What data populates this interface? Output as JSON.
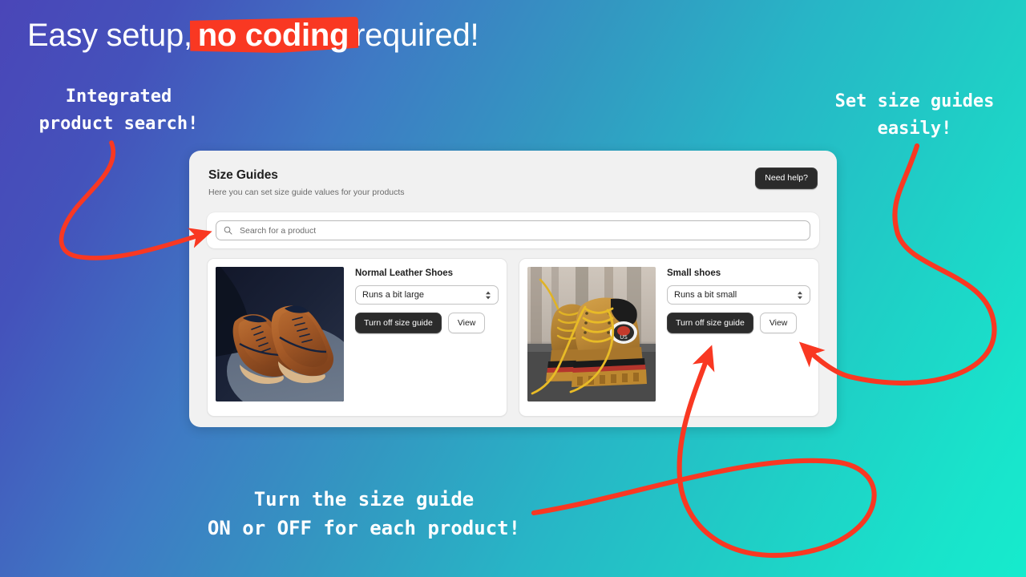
{
  "promo": {
    "headline_pre": "Easy setup,",
    "headline_highlight": "no coding",
    "headline_post": "required!",
    "callout_search": "Integrated\nproduct search!",
    "callout_sizes": "Set size guides\neasily!",
    "callout_toggle": "Turn the size guide\nON or OFF for each product!",
    "accent_color": "#f93822",
    "bg_from": "#4a46b8",
    "bg_to": "#16ebcd"
  },
  "app": {
    "title": "Size Guides",
    "subtitle": "Here you can set size guide values for your products",
    "need_help_label": "Need help?",
    "search": {
      "placeholder": "Search for a product",
      "value": "",
      "icon": "search-icon"
    },
    "products": [
      {
        "name": "Normal Leather Shoes",
        "fit_value": "Runs a bit large",
        "toggle_label": "Turn off size guide",
        "view_label": "View",
        "image": "brown-leather-oxford-shoes"
      },
      {
        "name": "Small shoes",
        "fit_value": "Runs a bit small",
        "toggle_label": "Turn off size guide",
        "view_label": "View",
        "image": "tan-work-boots"
      }
    ]
  }
}
